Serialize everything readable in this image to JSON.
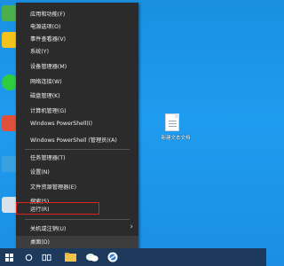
{
  "menu": {
    "items": [
      {
        "label": "应用和功能(F)"
      },
      {
        "label": "电源选项(O)"
      },
      {
        "label": "事件查看器(V)"
      },
      {
        "label": "系统(Y)"
      },
      {
        "label": "设备管理器(M)"
      },
      {
        "label": "网络连接(W)"
      },
      {
        "label": "磁盘管理(K)"
      },
      {
        "label": "计算机管理(G)"
      },
      {
        "label": "Windows PowerShell(I)"
      },
      {
        "label": "Windows PowerShell (管理员)(A)"
      },
      {
        "label": "任务管理器(T)"
      },
      {
        "label": "设置(N)"
      },
      {
        "label": "文件资源管理器(E)"
      },
      {
        "label": "搜索(S)"
      },
      {
        "label": "运行(R)"
      },
      {
        "label": "关机或注销(U)",
        "submenu": true
      },
      {
        "label": "桌面(D)"
      }
    ],
    "highlighted": "运行(R)"
  },
  "desktop": {
    "file_label": "新建文本文档"
  },
  "taskbar": {
    "items": [
      "windows-start-icon",
      "search-circle-icon",
      "task-view-icon",
      "file-explorer-icon",
      "wechat-icon",
      "browser-icon"
    ]
  },
  "colors": {
    "desktop": "#1e9cef",
    "menu_bg": "#2b2b2b",
    "taskbar_bg": "#1d3a5c",
    "highlight_border": "#e0201c"
  }
}
